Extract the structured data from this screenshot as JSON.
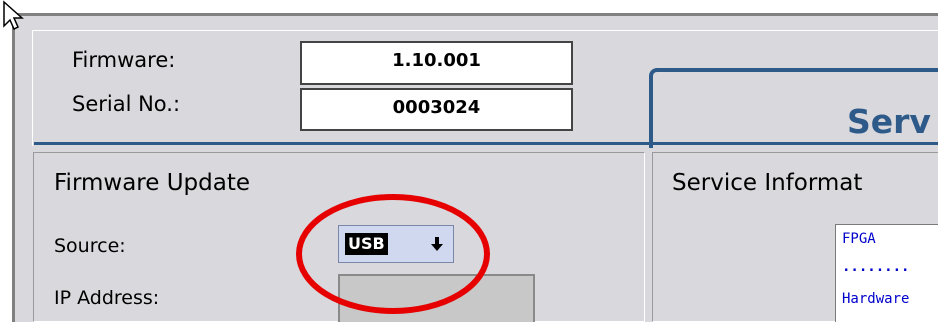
{
  "header": {
    "firmware_label": "Firmware:",
    "firmware_value": "1.10.001",
    "serial_label": "Serial No.:",
    "serial_value": "0003024",
    "service_title": "Serv"
  },
  "firmware_update": {
    "title": "Firmware Update",
    "source_label": "Source:",
    "source_value": "USB",
    "ip_label": "IP Address:",
    "ip_value": ""
  },
  "service_information": {
    "title": "Service Informat",
    "lines": [
      "FPGA",
      "........",
      "Hardware"
    ]
  },
  "colors": {
    "accent": "#2e5a8a",
    "panel_bg": "#d9d8dc",
    "annotation": "#e60000",
    "info_text": "#0000cc"
  },
  "icons": {
    "cursor": "arrow-cursor-icon",
    "dropdown": "dropdown-arrow-icon",
    "annotation": "red-ellipse-annotation"
  }
}
